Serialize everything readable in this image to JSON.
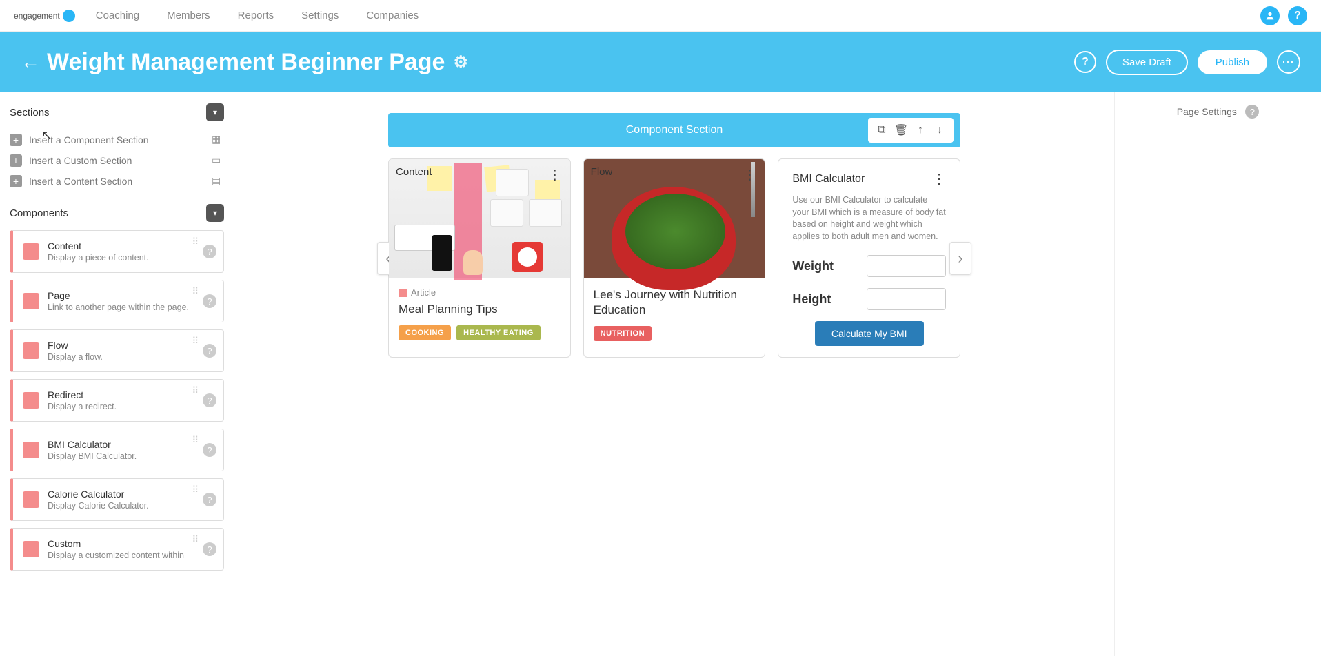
{
  "nav": {
    "logo_text": "engagement",
    "links": [
      "Coaching",
      "Members",
      "Reports",
      "Settings",
      "Companies"
    ]
  },
  "header": {
    "title": "Weight Management Beginner Page",
    "save_draft": "Save Draft",
    "publish": "Publish"
  },
  "sections": {
    "title": "Sections",
    "items": [
      "Insert a Component Section",
      "Insert a Custom Section",
      "Insert a Content Section"
    ]
  },
  "components": {
    "title": "Components",
    "items": [
      {
        "title": "Content",
        "desc": "Display a piece of content."
      },
      {
        "title": "Page",
        "desc": "Link to another page within the page."
      },
      {
        "title": "Flow",
        "desc": "Display a flow."
      },
      {
        "title": "Redirect",
        "desc": "Display a redirect."
      },
      {
        "title": "BMI Calculator",
        "desc": "Display BMI Calculator."
      },
      {
        "title": "Calorie Calculator",
        "desc": "Display Calorie Calculator."
      },
      {
        "title": "Custom",
        "desc": "Display a customized content within"
      }
    ]
  },
  "center": {
    "section_label": "Component Section",
    "card1": {
      "label": "Content",
      "type": "Article",
      "title": "Meal Planning Tips",
      "tags": [
        "COOKING",
        "HEALTHY EATING"
      ]
    },
    "card2": {
      "label": "Flow",
      "title": "Lee's Journey with Nutrition Education",
      "tags": [
        "NUTRITION"
      ]
    },
    "card3": {
      "title": "BMI Calculator",
      "desc": "Use our BMI Calculator to calculate your BMI which is a measure of body fat based on height and weight which applies to both adult men and women.",
      "weight_label": "Weight",
      "height_label": "Height",
      "button": "Calculate My BMI"
    }
  },
  "right": {
    "title": "Page Settings"
  }
}
